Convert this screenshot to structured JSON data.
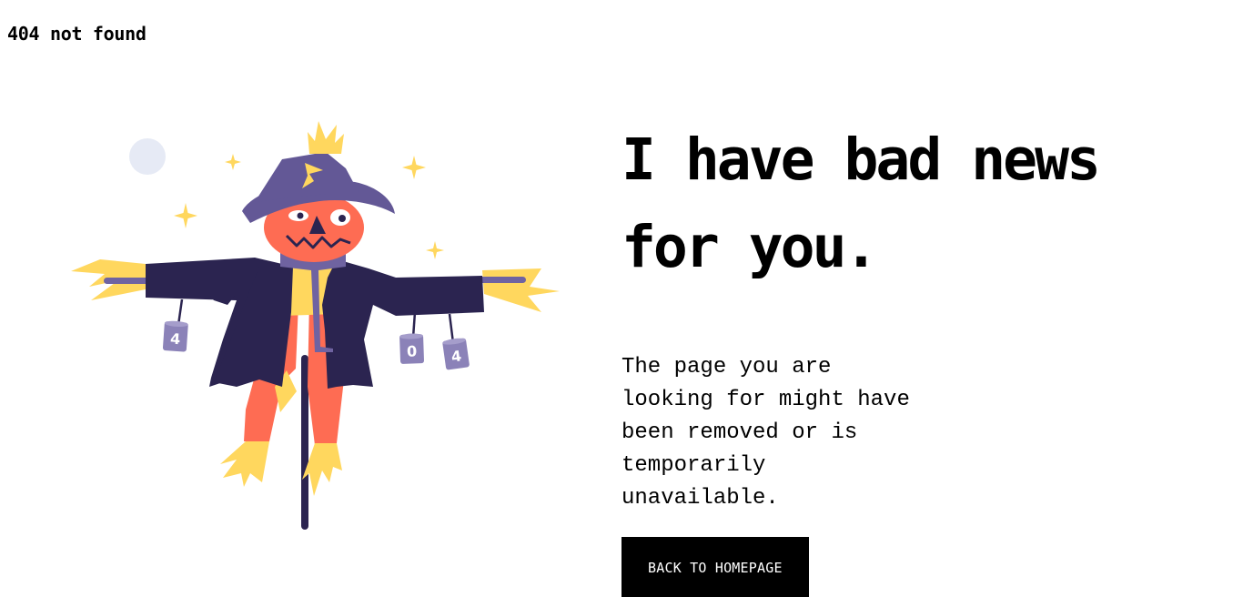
{
  "brand": {
    "label": "404 not found"
  },
  "illustration": {
    "icon": "scarecrow-illustration",
    "cans": [
      "4",
      "0",
      "4"
    ],
    "colors": {
      "coat": "#2b2450",
      "hat": "#635896",
      "face": "#fe6c53",
      "straw": "#ffd75e",
      "scarf": "#6f63a1",
      "can": "#8b82b8",
      "moon": "#e6eaf5"
    }
  },
  "main": {
    "headline": "I have bad news for you.",
    "message": "The page you are looking for might have been removed or is temporarily unavailable.",
    "cta_label": "BACK TO HOMEPAGE"
  },
  "colors": {
    "background": "#ffffff",
    "text": "#000000",
    "button_bg": "#000000",
    "button_text": "#ffffff"
  }
}
